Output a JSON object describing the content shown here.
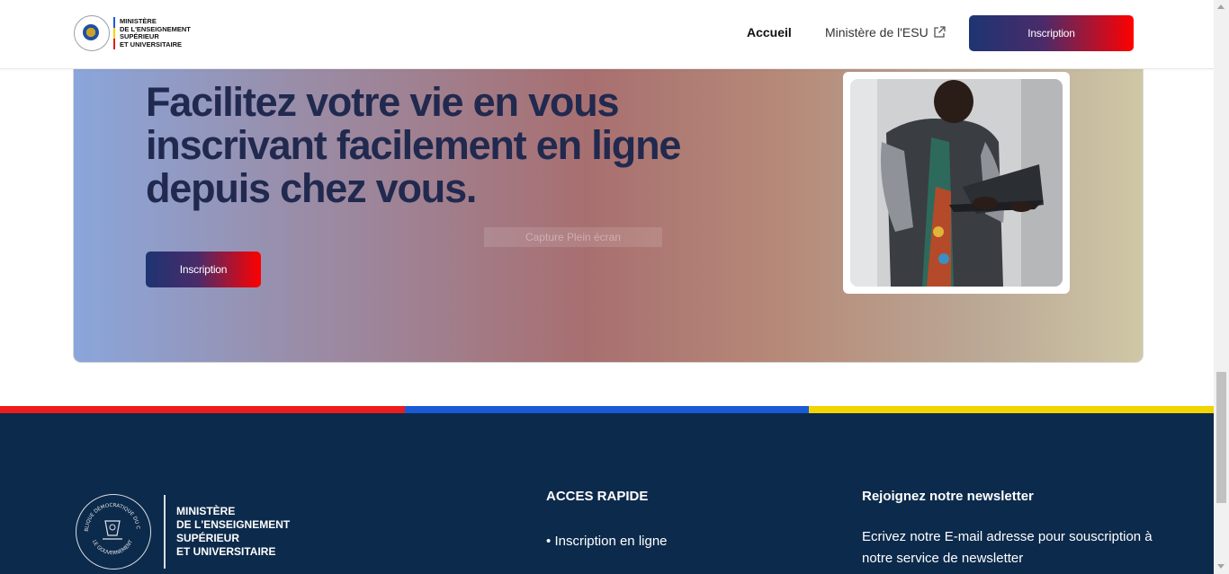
{
  "header": {
    "logo_lines": [
      "MINISTÈRE",
      "DE L'ENSEIGNEMENT",
      "SUPÉRIEUR",
      "ET UNIVERSITAIRE"
    ],
    "nav": {
      "home": "Accueil",
      "ministry": "Ministère de l'ESU"
    },
    "signup_button": "Inscription"
  },
  "hero": {
    "title": "Facilitez votre vie en vous inscrivant facilement en ligne depuis chez vous.",
    "button": "Inscription",
    "overlay_hint": "Capture Plein écran"
  },
  "stripe_colors": [
    "#ee1c1c",
    "#1a5ad7",
    "#f2d400"
  ],
  "footer": {
    "logo_lines": [
      "MINISTÈRE",
      "DE L'ENSEIGNEMENT",
      "SUPÉRIEUR",
      "ET UNIVERSITAIRE"
    ],
    "seal_text_top": "RÉPUBLIQUE DÉMOCRATIQUE DU CONGO",
    "seal_text_bottom": "LE GOUVERNEMENT",
    "quick_access": {
      "title": "ACCES RAPIDE",
      "links": [
        "Inscription en ligne"
      ]
    },
    "newsletter": {
      "title": "Rejoignez notre newsletter",
      "text": "Ecrivez notre E-mail adresse pour souscription à notre service de newsletter"
    }
  },
  "colors": {
    "brand_navy": "#1e3472",
    "brand_red": "#f00",
    "footer_bg": "#0c2a4b"
  },
  "icons": {
    "external": "external-link-icon"
  }
}
